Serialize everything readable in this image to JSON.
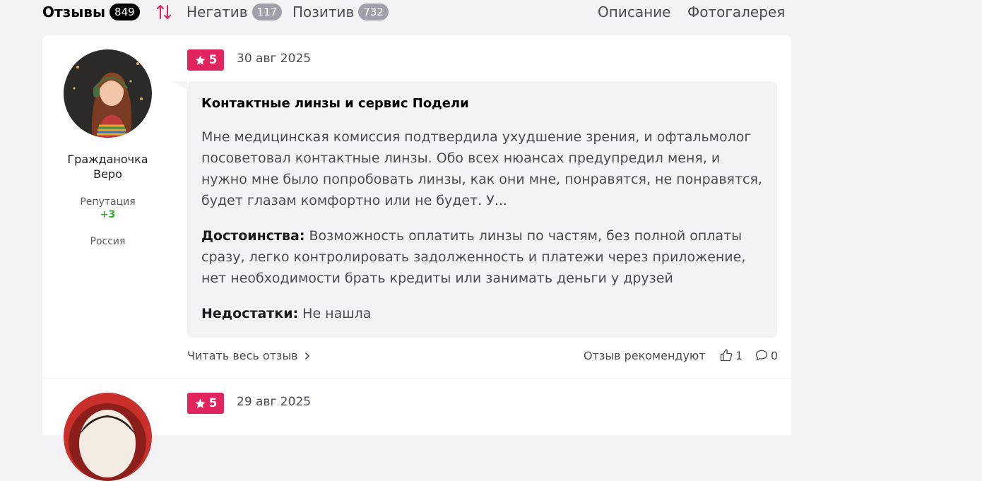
{
  "tabs": {
    "reviews_label": "Отзывы",
    "reviews_count": "849",
    "negative_label": "Негатив",
    "negative_count": "117",
    "positive_label": "Позитив",
    "positive_count": "732",
    "description_label": "Описание",
    "gallery_label": "Фотогалерея"
  },
  "review": {
    "author": "Гражданочка Веро",
    "reputation_label": "Репутация",
    "reputation_value": "+3",
    "country": "Россия",
    "rating": "5",
    "date": "30 авг 2025",
    "title": "Контактные линзы и сервис Подели",
    "text": "Мне медицинская комиссия подтвердила ухудшение зрения, и офтальмолог посоветовал контактные линзы. Обо всех нюансах предупредил меня, и нужно мне было попробовать линзы, как они мне, понравятся, не понравятся, будет глазам комфортно или не будет. У...",
    "pros_label": "Достоинства:",
    "pros_text": "Возможность оплатить линзы по частям, без полной оплаты сразу, легко контролировать задолженность и платежи через приложение, нет необходимости брать кредиты или занимать деньги у друзей",
    "cons_label": "Недостатки:",
    "cons_text": "Не нашла",
    "read_more": "Читать весь отзыв",
    "recommend_label": "Отзыв рекомендуют",
    "likes": "1",
    "comments": "0"
  },
  "review2": {
    "rating": "5",
    "date": "29 авг 2025"
  },
  "colors": {
    "accent": "#e0245e",
    "reputation": "#2eaa2e"
  }
}
